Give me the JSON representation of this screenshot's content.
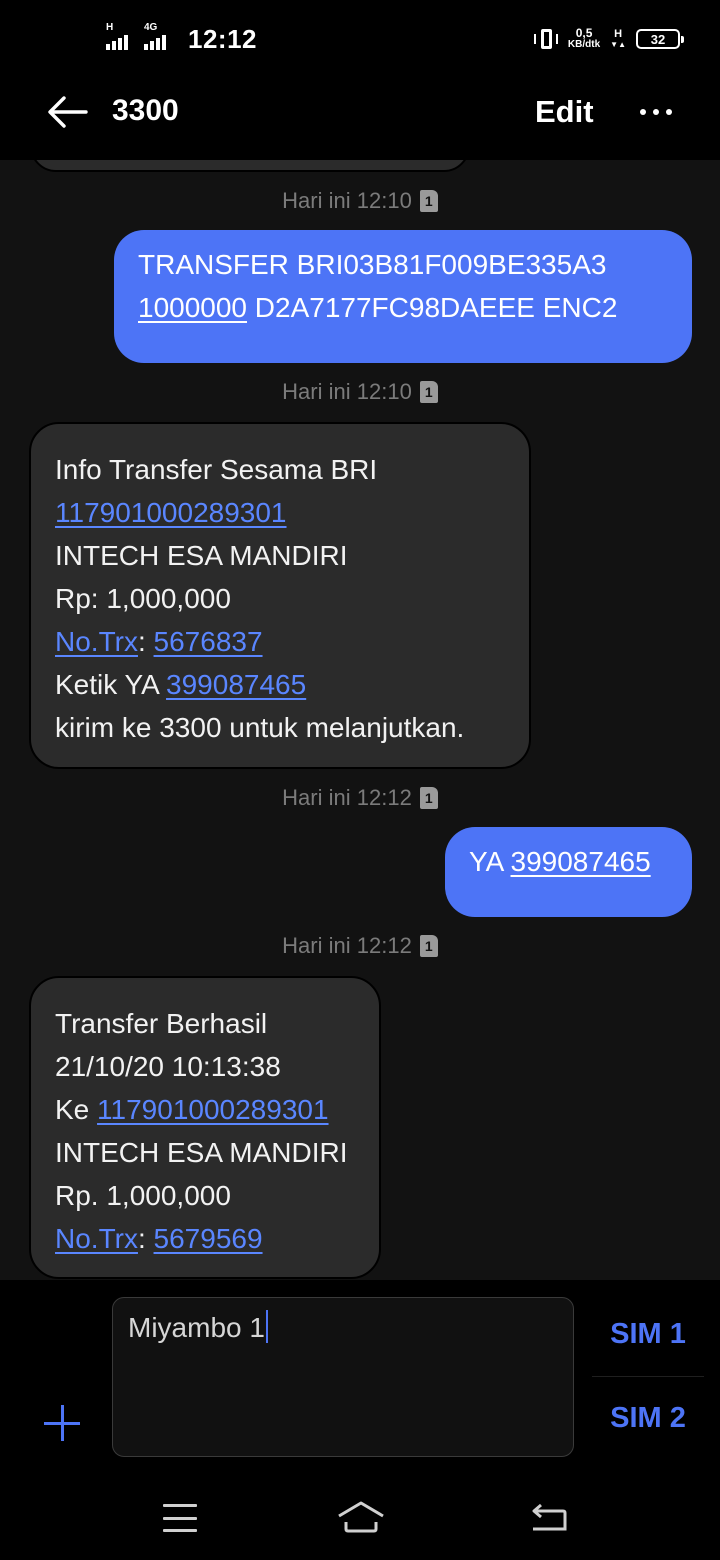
{
  "status_bar": {
    "time": "12:12",
    "sim1_network": "H",
    "sim2_network": "4G",
    "net_speed_value": "0,5",
    "net_speed_unit": "KB/dtk",
    "data_network": "H",
    "battery": "32"
  },
  "header": {
    "title": "3300",
    "edit_label": "Edit",
    "back_icon": "arrow-left-icon",
    "more_icon": "more-horizontal-icon"
  },
  "messages": [
    {
      "timestamp": "Hari ini 12:10",
      "sim": "1",
      "direction": "outgoing",
      "lines": [
        [
          {
            "text": "TRANSFER BRI03B81F009BE335A3"
          }
        ],
        [
          {
            "text": "1000000",
            "link": true
          },
          {
            "text": " D2A7177FC98DAEEE ENC2"
          }
        ]
      ]
    },
    {
      "timestamp": "Hari ini 12:10",
      "sim": "1",
      "direction": "incoming",
      "lines": [
        [
          {
            "text": "Info Transfer Sesama BRI"
          }
        ],
        [
          {
            "text": "117901000289301",
            "link": true
          }
        ],
        [
          {
            "text": "INTECH ESA MANDIRI"
          }
        ],
        [
          {
            "text": "Rp: 1,000,000"
          }
        ],
        [
          {
            "text": "No.Trx",
            "link": true
          },
          {
            "text": ": "
          },
          {
            "text": "5676837",
            "link": true
          }
        ],
        [
          {
            "text": "Ketik YA "
          },
          {
            "text": "399087465",
            "link": true
          }
        ],
        [
          {
            "text": "kirim ke 3300 untuk melanjutkan."
          }
        ]
      ]
    },
    {
      "timestamp": "Hari ini 12:12",
      "sim": "1",
      "direction": "outgoing",
      "lines": [
        [
          {
            "text": "YA "
          },
          {
            "text": "399087465",
            "link": true
          }
        ]
      ]
    },
    {
      "timestamp": "Hari ini 12:12",
      "sim": "1",
      "direction": "incoming",
      "lines": [
        [
          {
            "text": "Transfer Berhasil"
          }
        ],
        [
          {
            "text": "21/10/20 10:13:38"
          }
        ],
        [
          {
            "text": "Ke "
          },
          {
            "text": "117901000289301",
            "link": true
          }
        ],
        [
          {
            "text": "INTECH ESA MANDIRI"
          }
        ],
        [
          {
            "text": "Rp. 1,000,000"
          }
        ],
        [
          {
            "text": "No.Trx",
            "link": true
          },
          {
            "text": ": "
          },
          {
            "text": "5679569",
            "link": true
          }
        ]
      ]
    }
  ],
  "compose": {
    "value": "Miyambo 1",
    "sim1_label": "SIM 1",
    "sim2_label": "SIM 2",
    "add_icon": "plus-icon"
  },
  "colors": {
    "accent": "#4d74f6",
    "link": "#5a86ff",
    "incoming_bubble": "#2b2b2b",
    "background": "#121212",
    "timestamp": "#7b7b7b"
  },
  "nav_bar": {
    "menu_icon": "menu-icon",
    "home_icon": "home-icon",
    "back_icon": "back-icon"
  }
}
